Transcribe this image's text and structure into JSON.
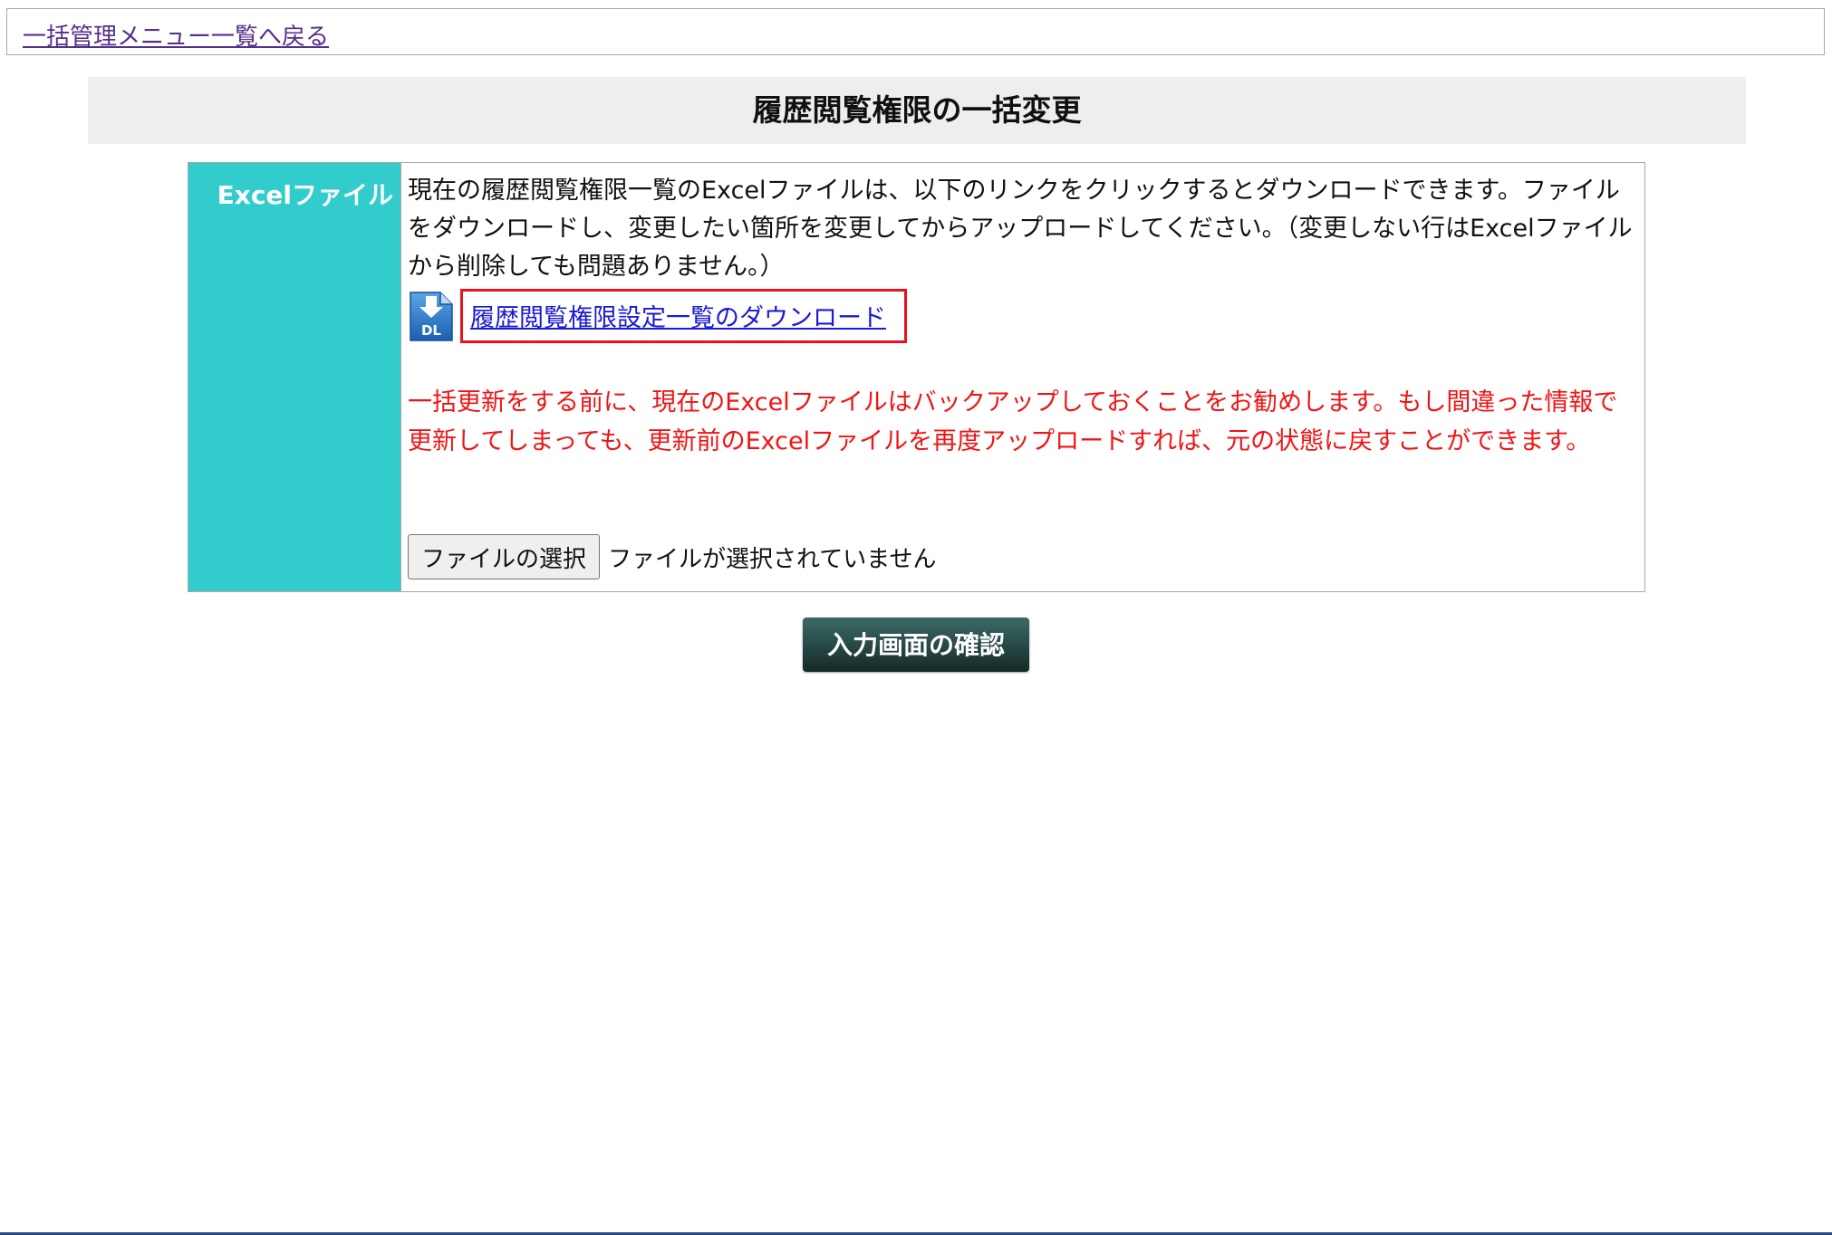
{
  "nav": {
    "back_link": "一括管理メニュー一覧へ戻る"
  },
  "page": {
    "title": "履歴閲覧権限の一括変更"
  },
  "form": {
    "label": "Excelファイル",
    "description": "現在の履歴閲覧権限一覧のExcelファイルは、以下のリンクをクリックするとダウンロードできます。ファイルをダウンロードし、変更したい箇所を変更してからアップロードしてください。（変更しない行はExcelファイルから削除しても問題ありません。）",
    "download_icon_text": "DL",
    "download_icon": "download-file-icon",
    "download_link": "履歴閲覧権限設定一覧のダウンロード",
    "warning": "一括更新をする前に、現在のExcelファイルはバックアップしておくことをお勧めします。もし間違った情報で更新してしまっても、更新前のExcelファイルを再度アップロードすれば、元の状態に戻すことができます。",
    "file_button": "ファイルの選択",
    "file_status": "ファイルが選択されていません"
  },
  "actions": {
    "confirm": "入力画面の確認"
  },
  "colors": {
    "label_bg": "#33cccc",
    "warning": "#f01414",
    "highlight_box": "#e6141e",
    "link": "#1a1ad6",
    "confirm_bg": "#1f3f3c"
  }
}
